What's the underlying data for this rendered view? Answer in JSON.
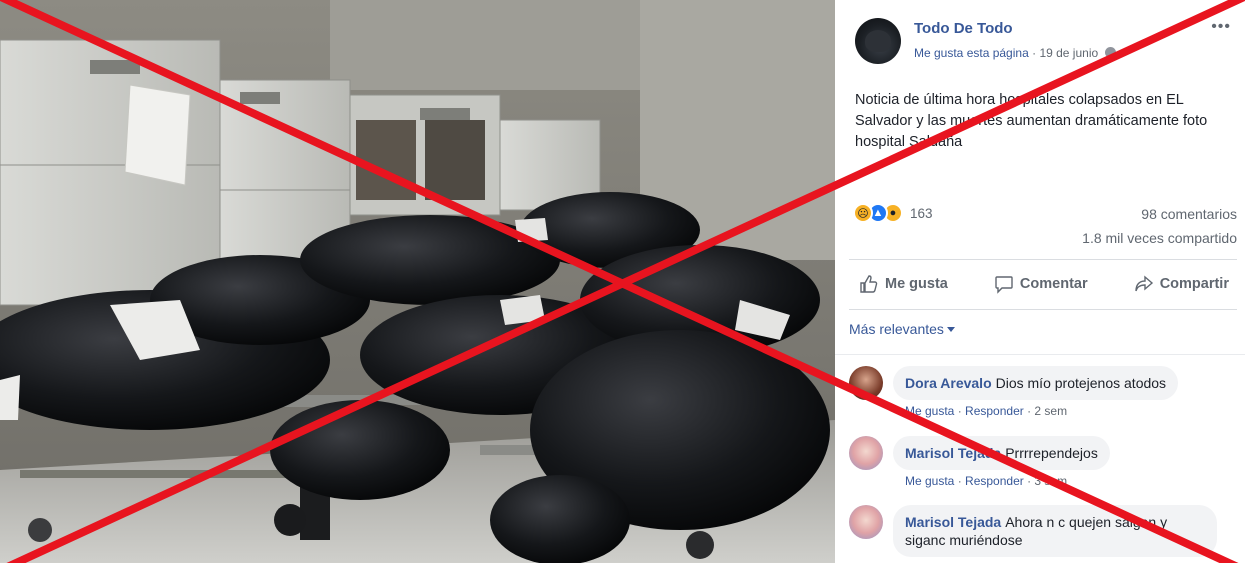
{
  "post": {
    "page_name": "Todo De Todo",
    "like_page": "Me gusta esta página",
    "separator": "·",
    "date": "19 de junio",
    "more": "•••",
    "text": "Noticia de última hora hospitales colapsados en EL Salvador y las muertes aumentan dramáticamente foto hospital Saldaña"
  },
  "stats": {
    "reaction_icons": [
      "sad-emoji",
      "like-thumb",
      "wow-emoji"
    ],
    "reactions_count": "163",
    "comments": "98 comentarios",
    "shares": "1.8 mil veces compartido"
  },
  "actions": {
    "like": "Me gusta",
    "comment": "Comentar",
    "share": "Compartir"
  },
  "comments_filter": "Más relevantes",
  "comments": [
    {
      "author": "Dora Arevalo",
      "text": "Dios mío protejenos atodos",
      "like": "Me gusta",
      "reply": "Responder",
      "time": "2 sem"
    },
    {
      "author": "Marisol Tejada",
      "text": "Prrrrependejos",
      "like": "Me gusta",
      "reply": "Responder",
      "time": "3 sem"
    },
    {
      "author": "Marisol Tejada",
      "text": "Ahora n c quejen salgan y siganc muriéndose"
    }
  ],
  "colors": {
    "link_blue": "#385898",
    "meta_gray": "#606770",
    "bubble_bg": "#f2f3f5",
    "cross_red": "#e8141f"
  }
}
